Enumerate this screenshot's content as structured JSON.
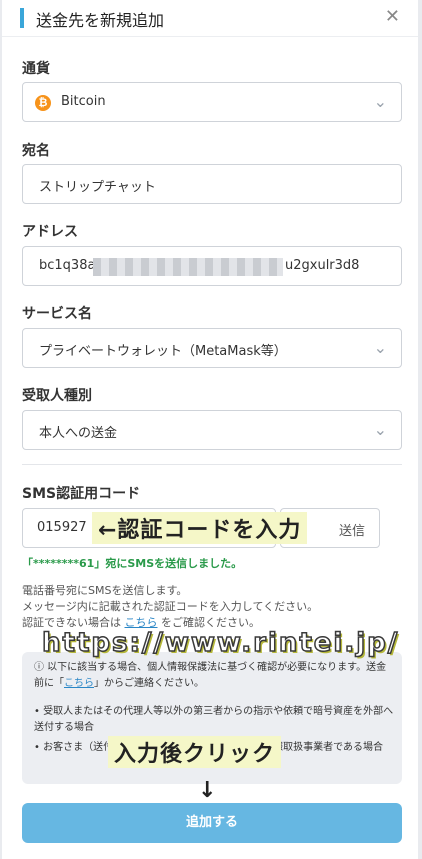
{
  "dialog": {
    "title": "送金先を新規追加"
  },
  "currency": {
    "label": "通貨",
    "selected": "Bitcoin"
  },
  "recipient_name": {
    "label": "宛名",
    "value": "ストリップチャット"
  },
  "address": {
    "label": "アドレス",
    "value_start": "bc1q38a",
    "value_end": "u2gxulr3d8"
  },
  "service": {
    "label": "サービス名",
    "selected": "プライベートウォレット（MetaMask等）"
  },
  "recipient_type": {
    "label": "受取人種別",
    "selected": "本人への送金"
  },
  "sms": {
    "label": "SMS認証用コード",
    "code_value": "015927",
    "send_button": "送信",
    "sent_message": "「********61」宛にSMSを送信しました。",
    "info_line1": "電話番号宛にSMSを送信します。",
    "info_line2": "メッセージ内に記載された認証コードを入力してください。",
    "info_line3_prefix": "認証できない場合は ",
    "info_line3_link": "こちら",
    "info_line3_suffix": " をご確認ください。"
  },
  "notice": {
    "line1": "ⓘ 以下に該当する場合、個人情報保護法に基づく確認が必要になります。送金前に「",
    "line1_link": "こちら",
    "line1_end": "」からご連絡ください。",
    "bullet1": "• 受取人またはその代理人等以外の第三者からの指示や依頼で暗号資産を外部へ送付する場合",
    "bullet2": "• お客さま（送付依頼人）から見て外国にある個人情報取扱事業者である場合"
  },
  "overlay": {
    "code_annotation": "←認証コードを入力",
    "watermark": "https://www.rintei.jp/",
    "click_annotation": "入力後クリック",
    "down_arrow": "↓"
  },
  "submit": {
    "label": "追加する"
  },
  "colors": {
    "accent": "#3aa6d9",
    "button": "#66b7e2",
    "success": "#2a9a4a",
    "bitcoin": "#f7931a"
  }
}
